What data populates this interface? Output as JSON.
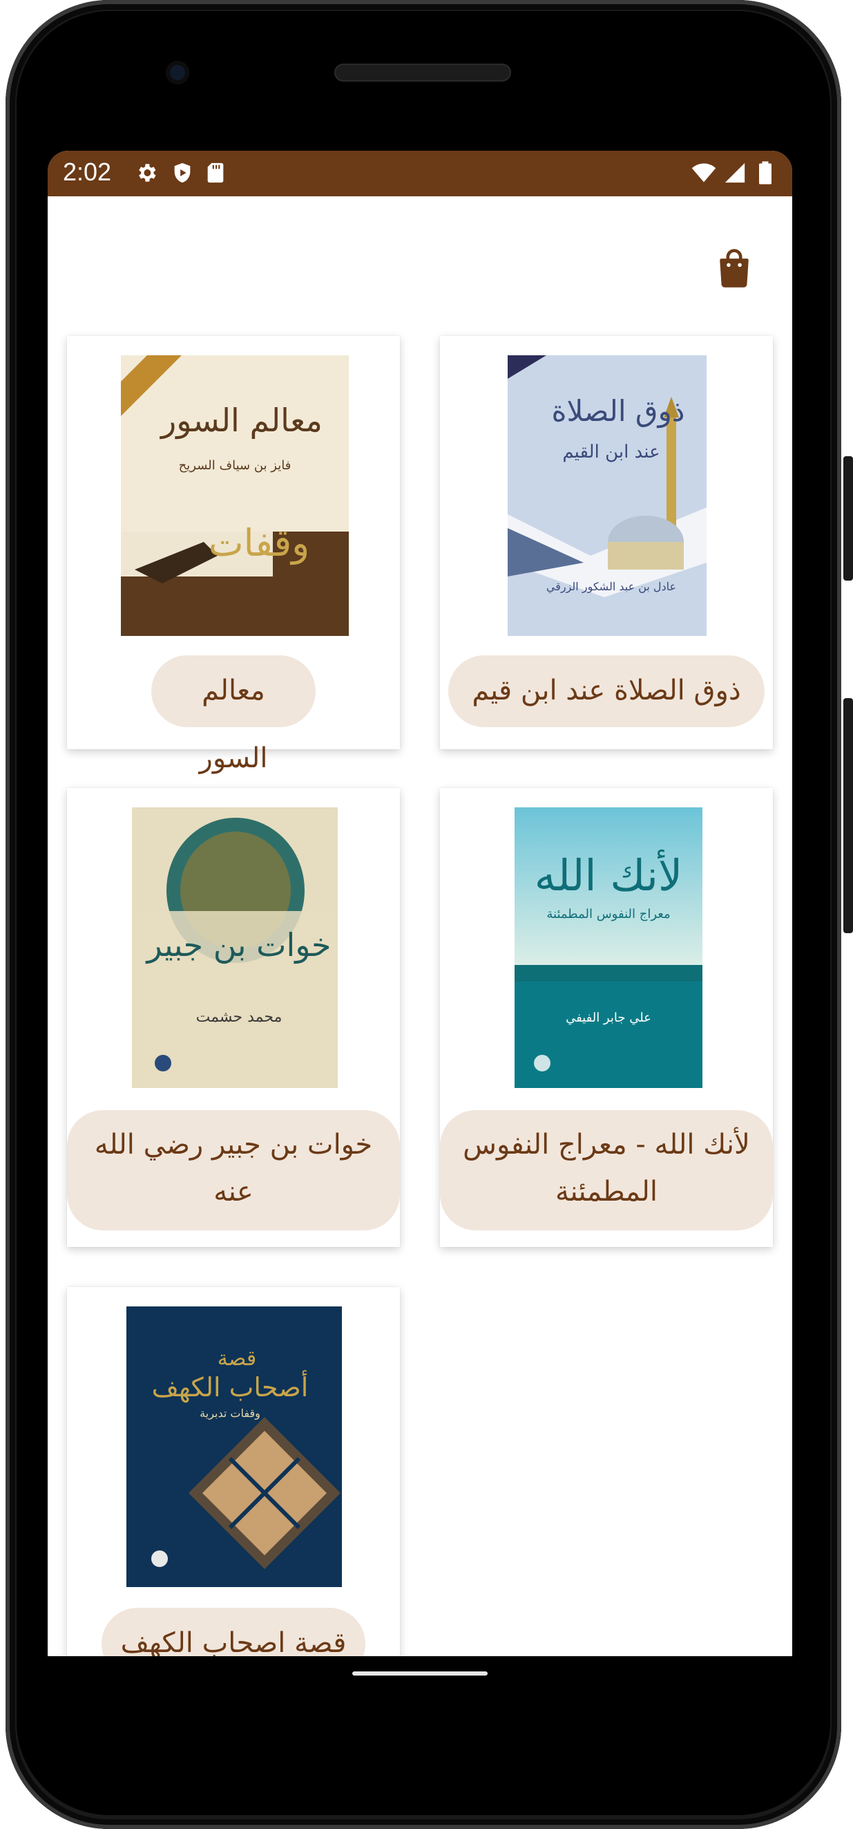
{
  "status_bar": {
    "time": "2:02",
    "left_icons": [
      "settings-icon",
      "shield-icon",
      "sd-card-icon"
    ],
    "right_icons": [
      "wifi-icon",
      "signal-icon",
      "battery-icon"
    ],
    "color": "#6b3a16"
  },
  "app_bar": {
    "action_icon": "shopping-bag-icon"
  },
  "colors": {
    "accent": "#6b3a16",
    "pill_bg": "#f1e6dc"
  },
  "books": [
    {
      "title": "ذوق الصلاة عند ابن قيم"
    },
    {
      "title": "معالم السور"
    },
    {
      "title": "لأنك الله - معراج النفوس المطمئنة"
    },
    {
      "title": "خوات بن جبير رضي الله عنه"
    },
    {
      "title": "قصة اصحاب الكهف"
    }
  ]
}
